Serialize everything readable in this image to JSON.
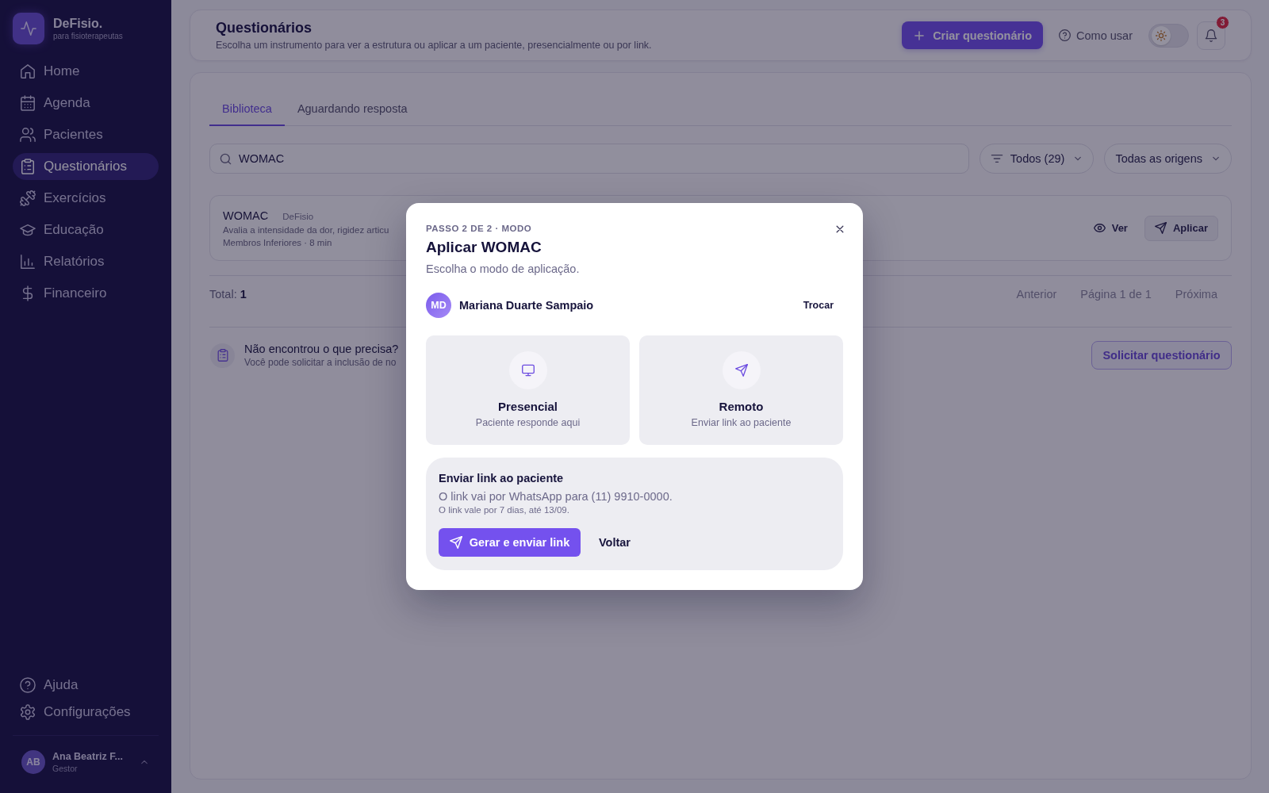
{
  "sidebar": {
    "brand": {
      "name": "DeFisio.",
      "tagline": "para fisioterapeutas"
    },
    "nav_items": [
      {
        "label": "Home",
        "selected": false
      },
      {
        "label": "Agenda",
        "selected": false
      },
      {
        "label": "Pacientes",
        "selected": false
      },
      {
        "label": "Questionários",
        "selected": true
      },
      {
        "label": "Exercícios",
        "selected": false
      },
      {
        "label": "Educação",
        "selected": false
      },
      {
        "label": "Relatórios",
        "selected": false
      },
      {
        "label": "Financeiro",
        "selected": false
      }
    ],
    "footer_items": [
      {
        "label": "Ajuda"
      },
      {
        "label": "Configurações"
      }
    ],
    "user": {
      "initials": "AB",
      "name": "Ana Beatriz F...",
      "role": "Gestor"
    }
  },
  "header": {
    "title": "Questionários",
    "subtitle": "Escolha um instrumento para ver a estrutura ou aplicar a um paciente, presencialmente ou por link.",
    "create_button": "Criar questionário",
    "help_link": "Como usar",
    "theme_toggle": {
      "on": false
    },
    "notification_count": "3"
  },
  "library": {
    "tabs": [
      {
        "label": "Biblioteca",
        "selected": true
      },
      {
        "label": "Aguardando resposta",
        "selected": false
      }
    ],
    "search": {
      "value": "WOMAC"
    },
    "filters": {
      "status": "Todos (29)",
      "origin": "Todas as origens"
    },
    "results": [
      {
        "name": "WOMAC",
        "source": "DeFisio",
        "description": "Avalia a intensidade da dor, rigidez articu",
        "meta": "Membros Inferiores · 8 min",
        "view_button": "Ver",
        "apply_button": "Aplicar"
      }
    ],
    "total": "Total: **1**",
    "pagination": {
      "previous": "Anterior",
      "page": "Página 1 de 1",
      "next": "Próxima"
    },
    "request": {
      "title": "Não encontrou o que precisa?",
      "text": "Você pode solicitar a inclusão de no",
      "button": "Solicitar questionário"
    }
  },
  "modal": {
    "step": "PASSO 2 DE 2 · MODO",
    "title": "Aplicar WOMAC",
    "subtitle": "Escolha o modo de aplicação.",
    "patient": {
      "initials": "MD",
      "name": "Mariana Duarte Sampaio",
      "change_button": "Trocar"
    },
    "modes": [
      {
        "title": "Presencial",
        "text": "Paciente responde aqui"
      },
      {
        "title": "Remoto",
        "text": "Enviar link ao paciente"
      }
    ],
    "link_panel": {
      "title": "Enviar link ao paciente",
      "text": "O link vai por WhatsApp para (11) 9910-0000.",
      "note": "O link vale por 7 dias, até 13/09.",
      "primary_button": "Gerar e enviar link",
      "secondary_button": "Voltar"
    }
  }
}
